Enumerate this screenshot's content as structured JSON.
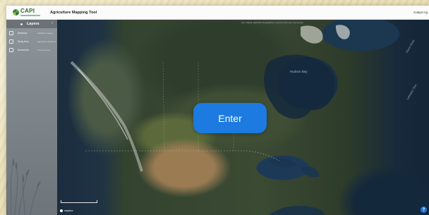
{
  "header": {
    "logo_text": "CAPI",
    "app_title": "Agriculture Mapping Tool",
    "user_name": "Analyst Ag"
  },
  "sidebar": {
    "title": "Layers",
    "layers": [
      {
        "name": "Basemap",
        "source": "Satellite Imagery"
      },
      {
        "name": "Study Area",
        "source": "Agriculture Regions"
      },
      {
        "name": "Boundaries",
        "source": "Province lines"
      }
    ]
  },
  "map": {
    "attribution": "Esri, Maxar, Earthstar Geographics, and the GIS User Community",
    "hudson_bay_label": "Hudson Bay",
    "labrador_sea_label": "Labrador Sea",
    "davis_strait_label": "Davis Strait",
    "map_logo": "mapbox",
    "enter_button": "Enter",
    "help_button": "?"
  },
  "colors": {
    "accent": "#1c7ae0",
    "sidebar": "#7f878d",
    "brand_green": "#2f6a33"
  }
}
